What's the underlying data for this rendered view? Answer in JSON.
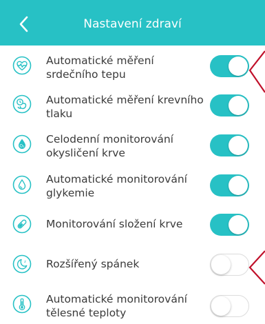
{
  "header": {
    "title": "Nastavení zdraví",
    "back_icon": "chevron-left-icon",
    "background": "#27c1c5"
  },
  "colors": {
    "accent": "#27c1c5",
    "icon": "#27c1c5",
    "annotation": "#c0102a",
    "toggle_off_border": "#dcdcdc"
  },
  "settings": [
    {
      "label": "Automatické měření srdečního tepu",
      "icon": "heart-rate-icon",
      "enabled": true
    },
    {
      "label": "Automatické měření krevního tlaku",
      "icon": "blood-pressure-icon",
      "enabled": true
    },
    {
      "label": "Celodenní monitorování okysličení krve",
      "icon": "blood-oxygen-icon",
      "enabled": true
    },
    {
      "label": "Automatické monitorování glykemie",
      "icon": "blood-glucose-icon",
      "enabled": true
    },
    {
      "label": "Monitorování složení krve",
      "icon": "blood-composition-icon",
      "enabled": true
    },
    {
      "label": "Rozšířený spánek",
      "icon": "sleep-icon",
      "enabled": false
    },
    {
      "label": "Automatické monitorování tělesné teploty",
      "icon": "thermometer-icon",
      "enabled": false
    }
  ]
}
